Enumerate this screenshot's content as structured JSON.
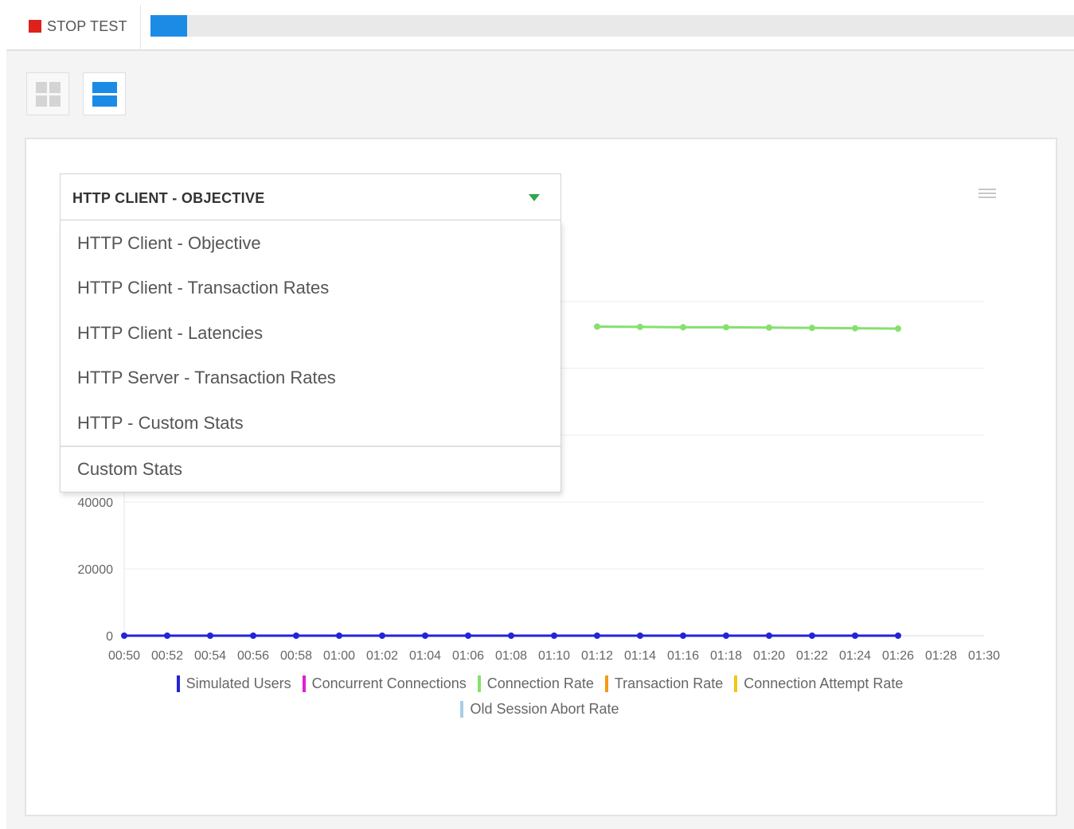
{
  "toolbar": {
    "stop_label": "STOP TEST",
    "stop_color": "#e0201b",
    "progress_fraction": 0.04,
    "progress_color": "#1c8be6"
  },
  "view_toggle": {
    "icons": [
      "grid-view-icon",
      "list-view-icon"
    ],
    "selected": "list-view-icon"
  },
  "chart_selector": {
    "selected_label": "HTTP CLIENT - OBJECTIVE",
    "options": [
      "HTTP Client - Objective",
      "HTTP Client - Transaction Rates",
      "HTTP Client - Latencies",
      "HTTP Server - Transaction Rates",
      "HTTP - Custom Stats"
    ],
    "extra_option": "Custom Stats"
  },
  "chart_data": {
    "type": "line",
    "x": [
      "00:50",
      "00:52",
      "00:54",
      "00:56",
      "00:58",
      "01:00",
      "01:02",
      "01:04",
      "01:06",
      "01:08",
      "01:10",
      "01:12",
      "01:14",
      "01:16",
      "01:18",
      "01:20",
      "01:22",
      "01:24",
      "01:26",
      "01:28",
      "01:30"
    ],
    "y_ticks_visible": [
      0,
      20000,
      40000
    ],
    "ylim": [
      0,
      110000
    ],
    "grid": true,
    "legend_position": "bottom",
    "series": [
      {
        "name": "Simulated Users",
        "color": "#2323d8",
        "values": [
          0,
          0,
          0,
          0,
          0,
          0,
          0,
          0,
          0,
          0,
          0,
          0,
          0,
          0,
          0,
          0,
          0,
          0,
          0,
          null,
          null
        ]
      },
      {
        "name": "Concurrent Connections",
        "color": "#e01ed5",
        "values": []
      },
      {
        "name": "Connection Rate",
        "color": "#86e06e",
        "values": [
          null,
          null,
          null,
          null,
          null,
          null,
          null,
          null,
          null,
          null,
          null,
          92500,
          92400,
          92300,
          92300,
          92200,
          92100,
          92000,
          91900,
          null,
          null
        ]
      },
      {
        "name": "Transaction Rate",
        "color": "#f39c12",
        "values": []
      },
      {
        "name": "Connection Attempt Rate",
        "color": "#f5c518",
        "values": []
      },
      {
        "name": "Old Session Abort Rate",
        "color": "#a8cde8",
        "values": []
      }
    ]
  }
}
